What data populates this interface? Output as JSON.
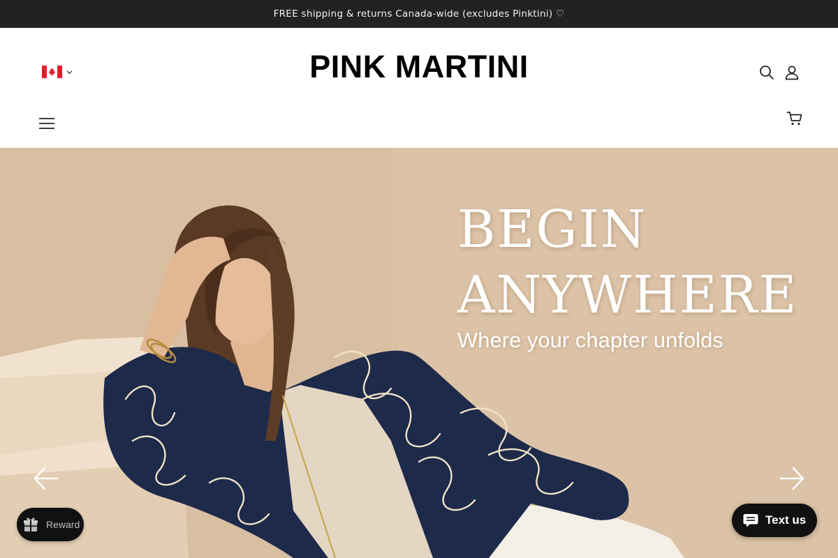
{
  "announcement": {
    "text": "FREE shipping & returns Canada-wide (excludes Pinktini) ♡"
  },
  "header": {
    "brand": "PINK MARTINI",
    "country_selector": {
      "flag_icon": "canada-flag-icon",
      "chevron_icon": "chevron-down-icon"
    },
    "icons": {
      "search": "search-icon",
      "account": "user-icon",
      "menu": "hamburger-menu-icon",
      "cart": "shopping-cart-icon"
    }
  },
  "hero": {
    "title_line1": "BEGIN",
    "title_line2": "ANYWHERE",
    "subtitle": "Where your chapter unfolds",
    "prev_icon": "arrow-left-icon",
    "next_icon": "arrow-right-icon"
  },
  "widgets": {
    "reward_label": "Reward",
    "text_us_label": "Text us"
  },
  "colors": {
    "announcement_bg": "#222222",
    "hero_bg": "#dcc3a7",
    "jacket_navy": "#1e2a4a",
    "widget_bg": "#111111"
  }
}
